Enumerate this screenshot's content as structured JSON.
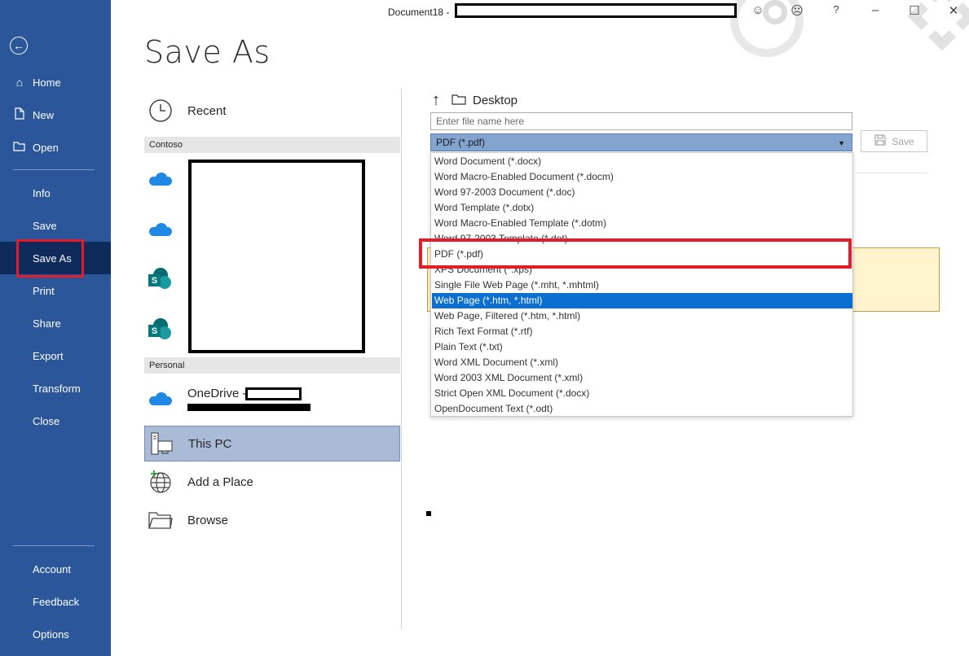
{
  "window": {
    "doc_title": "Document18  -",
    "help": "?"
  },
  "nav": {
    "back": "←",
    "items": [
      {
        "label": "Home"
      },
      {
        "label": "New"
      },
      {
        "label": "Open"
      },
      {
        "label": "Info"
      },
      {
        "label": "Save"
      },
      {
        "label": "Save As"
      },
      {
        "label": "Print"
      },
      {
        "label": "Share"
      },
      {
        "label": "Export"
      },
      {
        "label": "Transform"
      },
      {
        "label": "Close"
      },
      {
        "label": "Account"
      },
      {
        "label": "Feedback"
      },
      {
        "label": "Options"
      }
    ],
    "active": "Save As"
  },
  "page": {
    "title": "Save As"
  },
  "locations": {
    "recent": "Recent",
    "section_contoso": "Contoso",
    "section_personal": "Personal",
    "onedrive": "OneDrive -",
    "this_pc": "This PC",
    "add_place": "Add a Place",
    "browse": "Browse"
  },
  "save_pane": {
    "path": "Desktop",
    "filename_placeholder": "Enter file name here",
    "selected_type": "PDF (*.pdf)",
    "save_label": "Save",
    "file_types": [
      "Word Document (*.docx)",
      "Word Macro-Enabled Document (*.docm)",
      "Word 97-2003 Document (*.doc)",
      "Word Template (*.dotx)",
      "Word Macro-Enabled Template (*.dotm)",
      "Word 97-2003 Template (*.dot)",
      "PDF (*.pdf)",
      "XPS Document (*.xps)",
      "Single File Web Page (*.mht, *.mhtml)",
      "Web Page (*.htm, *.html)",
      "Web Page, Filtered (*.htm, *.html)",
      "Rich Text Format (*.rtf)",
      "Plain Text (*.txt)",
      "Word XML Document (*.xml)",
      "Word 2003 XML Document (*.xml)",
      "Strict Open XML Document (*.docx)",
      "OpenDocument Text (*.odt)"
    ],
    "highlighted_type": "Web Page (*.htm, *.html)"
  },
  "colors": {
    "nav_bg": "#2b579a",
    "nav_active": "#0e2b5c",
    "annotation_red": "#e21c2a",
    "dropdown_selected": "#0a6fd0",
    "select_bg": "#82a4cf"
  }
}
